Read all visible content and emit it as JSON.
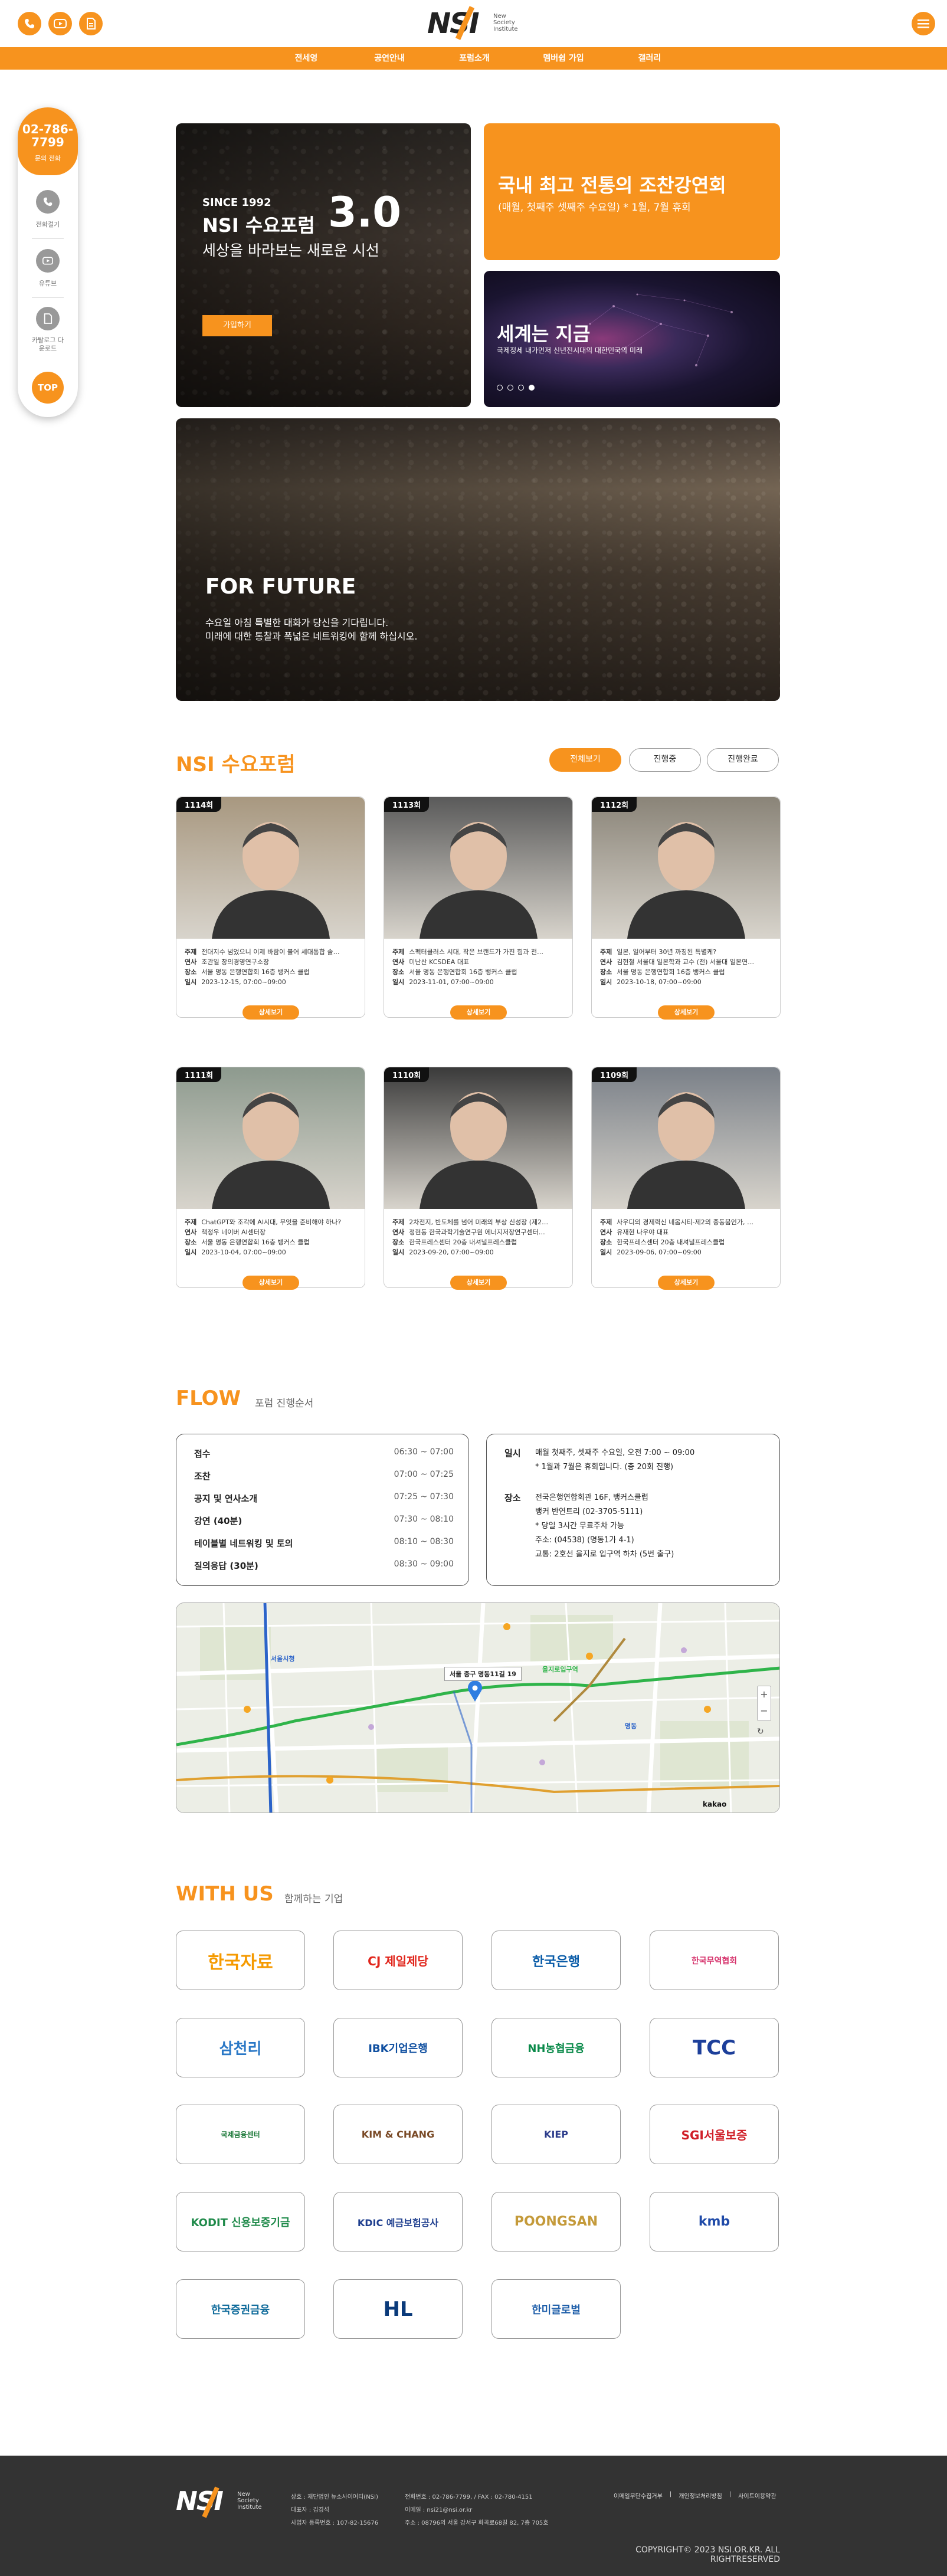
{
  "header": {
    "logo_text": "NSI",
    "logo_sub": [
      "New",
      "Society",
      "Institute"
    ],
    "icons": [
      "phone-icon",
      "youtube-icon",
      "document-icon",
      "menu-icon"
    ]
  },
  "nav": [
    "전세영",
    "공연안내",
    "포럼소개",
    "멤버쉽 가입",
    "갤러리"
  ],
  "side": {
    "phone": "02-786-7799",
    "phone_label": "문의 전화",
    "buttons": [
      "전화걸기",
      "유튜브",
      "카탈로그 다운로드"
    ],
    "top": "TOP"
  },
  "hero": {
    "since": "SINCE 1992",
    "title": "NSI 수요포럼",
    "version": "3.0",
    "subtitle": "세상을 바라보는 새로운 시선",
    "join": "가입하기",
    "box1_title": "국내 최고 전통의 조찬강연회",
    "box1_sub": "(매월, 첫째주 셋째주 수요일) * 1월, 7월 휴회",
    "box2_title": "세계는 지금",
    "box2_sub": "국제정세 내가먼저 신년전시대의 대한민국의 미래",
    "future_title": "FOR FUTURE",
    "future_line1": "수요일 아침 특별한 대화가 당신을 기다립니다.",
    "future_line2": "미래에 대한 통찰과 폭넓은 네트워킹에 함께 하십시오."
  },
  "forum": {
    "title": "NSI 수요포럼",
    "filters": [
      "전체보기",
      "진행중",
      "진행완료"
    ],
    "labels": [
      "주제",
      "연사",
      "장소",
      "일시"
    ],
    "more": "상세보기",
    "cards": [
      {
        "no": "1114회",
        "topic": "전대지수 넘었으니 이제 바람이 불어 세대통합 솔…",
        "speaker": "조관일 창의경영연구소장",
        "place": "서울 명동 은행연합회 16층 뱅커스 클럽",
        "date": "2023-12-15, 07:00~09:00"
      },
      {
        "no": "1113회",
        "topic": "스펙터클러스 시대, 작은 브랜드가 가진 힘과 전…",
        "speaker": "미난산 KCSDEA 대표",
        "place": "서울 명동 은행연합회 16층 뱅커스 클럽",
        "date": "2023-11-01, 07:00~09:00"
      },
      {
        "no": "1112회",
        "topic": "일본, 일어부터 30년 까칭된 특별케?",
        "speaker": "김현철 서울대 일본학과 교수 (전) 서울대 일본연…",
        "place": "서울 명동 은행연합회 16층 뱅커스 클럽",
        "date": "2023-10-18, 07:00~09:00"
      },
      {
        "no": "1111회",
        "topic": "ChatGPT와 조각에 AI시대, 무엇을 준비해야 하나?",
        "speaker": "책정우 네이버 AI센터장",
        "place": "서울 명동 은행연합회 16층 뱅커스 클럽",
        "date": "2023-10-04, 07:00~09:00"
      },
      {
        "no": "1110회",
        "topic": "2차전지, 반도체를 넘어 미래의 부상 신성장 (제2…",
        "speaker": "정현동 한국과학기술연구원 에너지저장연구센터…",
        "place": "한국프레스센터 20층 내셔널프레스클럽",
        "date": "2023-09-20, 07:00~09:00"
      },
      {
        "no": "1109회",
        "topic": "사우디의 경제력신 네옴시티-제2의 중동붐인가, …",
        "speaker": "유재현 나우야 대표",
        "place": "한국프레스센터 20층 내셔널프레스클럽",
        "date": "2023-09-06, 07:00~09:00"
      }
    ]
  },
  "flow": {
    "title": "FLOW",
    "sub": "포럼 진행순서",
    "steps": [
      {
        "name": "접수",
        "time": "06:30 ~ 07:00"
      },
      {
        "name": "조찬",
        "time": "07:00 ~ 07:25"
      },
      {
        "name": "공지 및 연사소개",
        "time": "07:25 ~ 07:30"
      },
      {
        "name": "강연 (40분)",
        "time": "07:30 ~ 08:10"
      },
      {
        "name": "테이블별 네트워킹 및 토의",
        "time": "08:10 ~ 08:30"
      },
      {
        "name": "질의응답 (30분)",
        "time": "08:30 ~ 09:00"
      }
    ],
    "info_date_label": "일시",
    "info_date": "매월 첫째주, 셋째주 수요일, 오전 7:00 ~ 09:00",
    "info_date_note": "* 1월과 7월은 휴회입니다. (총 20회 진행)",
    "info_place_label": "장소",
    "info_place_lines": [
      "전국은행연합회관 16F, 뱅커스클럽",
      "뱅커 반연트리 (02-3705-5111)",
      "* 당일 3시간 무료주차 가능",
      "주소: (04538) (명동1가 4-1)",
      "교통: 2호선 을지로 입구역 하차 (5번 출구)"
    ]
  },
  "map": {
    "pin_label": "서울 중구 명동11길 19",
    "stations": [
      "서울시청",
      "을지로입구역",
      "명동"
    ],
    "logo": "kakao"
  },
  "partners": {
    "title": "WITH US",
    "sub": "함께하는 기업",
    "items": [
      "한국자료",
      "CJ 제일제당",
      "한국은행",
      "한국무역협회",
      "삼천리",
      "IBK기업은행",
      "NH농협금융",
      "TCC",
      "국제금융센터",
      "KIM & CHANG",
      "KIEP",
      "SGI서울보증",
      "KODIT 신용보증기금",
      "KDIC 예금보험공사",
      "POONGSAN",
      "kmb",
      "한국증권금융",
      "HL",
      "한미글로벌"
    ]
  },
  "footer": {
    "lines": [
      "상호 : 재단법인 뉴소사이어티(NSI)",
      "대표자 : 김경석",
      "사업자 등록번호 : 107-82-15676",
      "전화번호 : 02-786-7799, / FAX : 02-780-4151",
      "이메일 : nsi21@nsi.or.kr",
      "주소 : 08796의 서울 강서구 화곡로68길 82, 7층 705호"
    ],
    "links": [
      "이메일무단수집거부",
      "개인정보처리방침",
      "사이트이용약관"
    ],
    "copyright": "COPYRIGHT© 2023 NSI.OR.KR. ALL RIGHTRESERVED"
  },
  "colors": {
    "accent": "#f7931e",
    "dark": "#333333"
  }
}
